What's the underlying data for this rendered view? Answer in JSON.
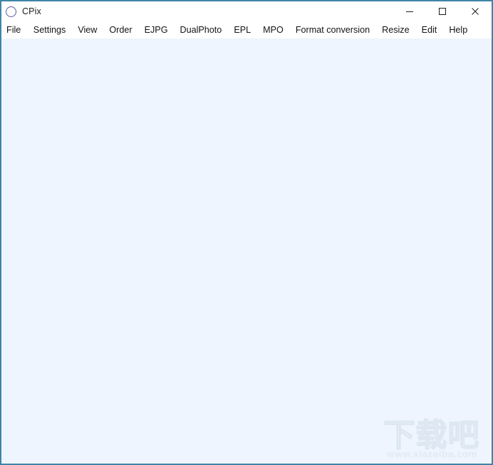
{
  "window": {
    "title": "CPix",
    "icon": "circle-outline-icon",
    "border_color": "#3f85a8",
    "titlebar_bg": "#ffffff",
    "canvas_bg": "#eff5fe"
  },
  "window_controls": {
    "minimize": {
      "name": "minimize-button",
      "glyph": "minimize-icon"
    },
    "maximize": {
      "name": "maximize-button",
      "glyph": "maximize-icon"
    },
    "close": {
      "name": "close-button",
      "glyph": "close-icon"
    }
  },
  "menu": {
    "items": [
      {
        "label": "File"
      },
      {
        "label": "Settings"
      },
      {
        "label": "View"
      },
      {
        "label": "Order"
      },
      {
        "label": "EJPG"
      },
      {
        "label": "DualPhoto"
      },
      {
        "label": "EPL"
      },
      {
        "label": "MPO"
      },
      {
        "label": "Format conversion"
      },
      {
        "label": "Resize"
      },
      {
        "label": "Edit"
      },
      {
        "label": "Help"
      }
    ]
  },
  "client": {
    "content": ""
  },
  "watermark": {
    "logo": "下载吧",
    "url": "www.xiazaiba.com",
    "color": "#dde7f2"
  }
}
